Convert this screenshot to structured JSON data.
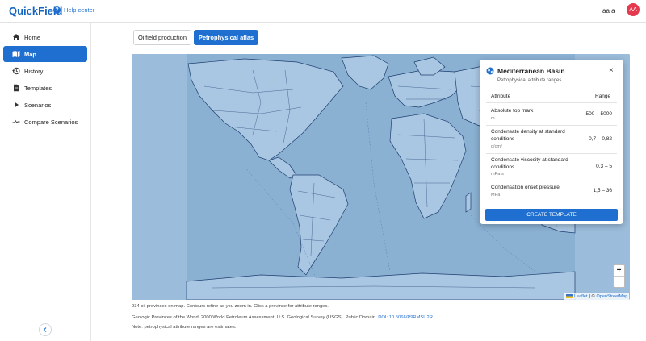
{
  "header": {
    "brand": "QuickField",
    "help_label": "Help center",
    "user_name": "aa a",
    "avatar_initials": "AA",
    "brand_color": "#1565c0",
    "avatar_color": "#e53950"
  },
  "sidebar": {
    "items": [
      {
        "label": "Home",
        "icon": "home-icon"
      },
      {
        "label": "Map",
        "icon": "map-icon",
        "active": true
      },
      {
        "label": "History",
        "icon": "history-icon"
      },
      {
        "label": "Templates",
        "icon": "document-icon"
      },
      {
        "label": "Scenarios",
        "icon": "play-icon"
      },
      {
        "label": "Compare Scenarios",
        "icon": "compare-icon"
      }
    ],
    "accent_color": "#1e6fd0"
  },
  "tabs": {
    "oilfield": "Oilfield production",
    "petro": "Petrophysical atlas"
  },
  "panel": {
    "title": "Mediterranean Basin",
    "subtitle": "Petrophysical attribute ranges",
    "header_attribute": "Attribute",
    "header_range": "Range",
    "rows": [
      {
        "name": "Absolute top mark",
        "unit": "m",
        "range": "500 – 5000"
      },
      {
        "name": "Condensate density at standard conditions",
        "unit": "g/cm³",
        "range": "0,7 – 0,82"
      },
      {
        "name": "Condensate viscosity at standard conditions",
        "unit": "mPa·s",
        "range": "0,3 – 5"
      },
      {
        "name": "Condensation onset pressure",
        "unit": "MPa",
        "range": "1,5 – 36"
      }
    ],
    "button": "CREATE TEMPLATE"
  },
  "map": {
    "zoom_in": "+",
    "zoom_out": "−",
    "attribution_leaflet": "Leaflet",
    "attribution_sep": "| ©",
    "attribution_osm": "OpenStreetMap",
    "ocean_color": "#8fb3d4",
    "land_color": "#a9c6e2",
    "outline_color": "#1f3f70"
  },
  "captions": {
    "line1": "934 oil provinces on map. Contours refine as you zoom in. Click a province for attribute ranges.",
    "line2": "Geologic Provinces of the World: 2000 World Petroleum Assessment. U.S. Geological Survey (USGS). Public Domain.",
    "doi": "DOI: 10.5066/P9RMSU2R",
    "line3": "Note: petrophysical attribute ranges are estimates."
  }
}
